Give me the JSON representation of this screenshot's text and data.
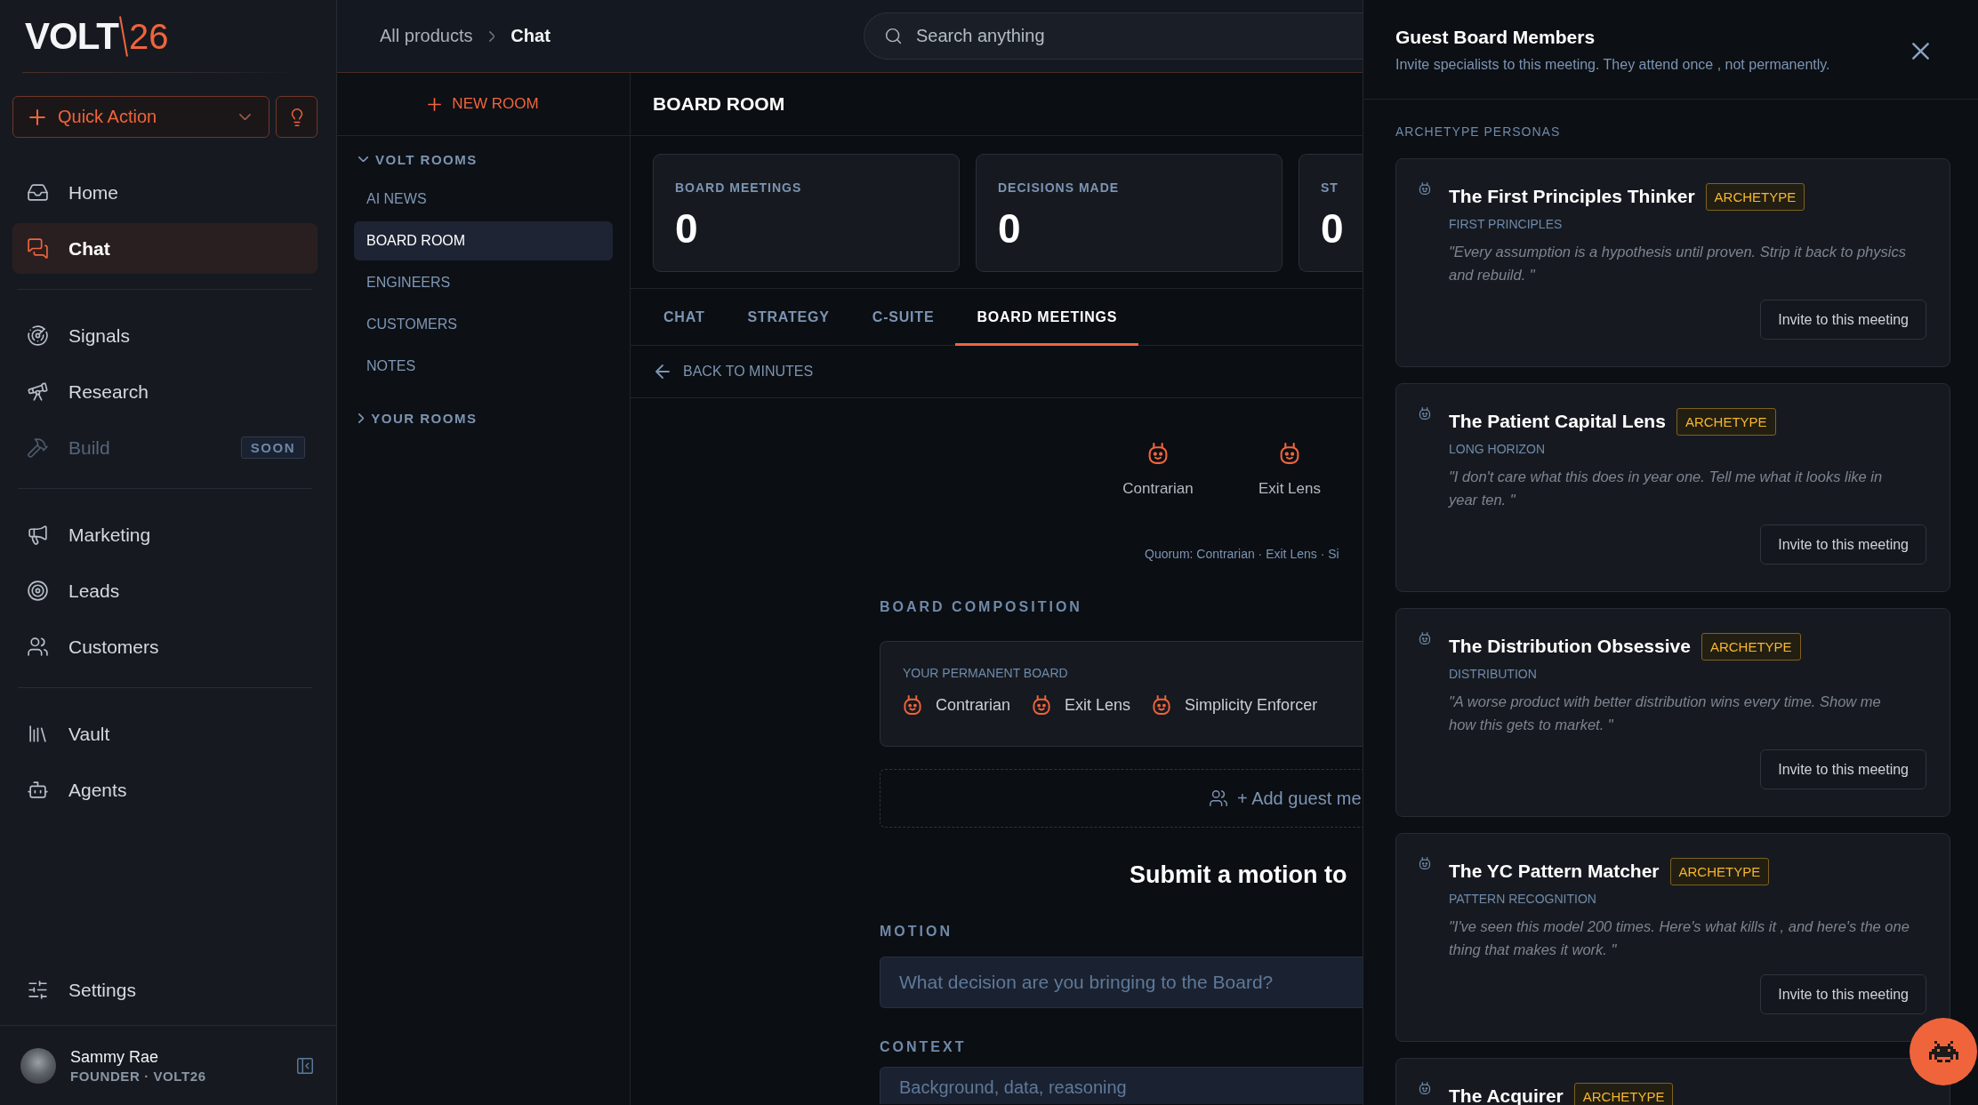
{
  "sidebar": {
    "logo": {
      "word": "VOLT",
      "number": "26"
    },
    "quick_action": {
      "label": "Quick Action"
    },
    "nav_sections": [
      {
        "items": [
          {
            "label": "Home",
            "selected": false,
            "disabled": false
          },
          {
            "label": "Chat",
            "selected": true,
            "disabled": false
          }
        ]
      },
      {
        "items": [
          {
            "label": "Signals",
            "selected": false,
            "disabled": false
          },
          {
            "label": "Research",
            "selected": false,
            "disabled": false
          },
          {
            "label": "Build",
            "selected": false,
            "disabled": true,
            "badge": "SOON"
          }
        ]
      },
      {
        "items": [
          {
            "label": "Marketing",
            "selected": false,
            "disabled": false
          },
          {
            "label": "Leads",
            "selected": false,
            "disabled": false
          },
          {
            "label": "Customers",
            "selected": false,
            "disabled": false
          }
        ]
      },
      {
        "items": [
          {
            "label": "Vault",
            "selected": false,
            "disabled": false
          },
          {
            "label": "Agents",
            "selected": false,
            "disabled": false
          }
        ]
      }
    ],
    "settings": {
      "label": "Settings"
    },
    "user": {
      "name": "Sammy Rae",
      "role": "FOUNDER · VOLT26"
    }
  },
  "topbar": {
    "breadcrumb": [
      "All products",
      "Chat"
    ],
    "search": {
      "placeholder": "Search anything"
    }
  },
  "rooms": {
    "new_room": "NEW ROOM",
    "groups": [
      {
        "label": "VOLT ROOMS",
        "expanded": true,
        "rooms": [
          {
            "label": "AI NEWS",
            "selected": false
          },
          {
            "label": "BOARD ROOM",
            "selected": true
          },
          {
            "label": "ENGINEERS",
            "selected": false
          },
          {
            "label": "CUSTOMERS",
            "selected": false
          },
          {
            "label": "NOTES",
            "selected": false
          }
        ]
      },
      {
        "label": "YOUR ROOMS",
        "expanded": false
      }
    ]
  },
  "main": {
    "title": "BOARD ROOM",
    "stats": [
      {
        "label": "BOARD MEETINGS",
        "value": "0"
      },
      {
        "label": "DECISIONS MADE",
        "value": "0"
      },
      {
        "label": "ST",
        "value": "0"
      }
    ],
    "tabs": [
      {
        "label": "CHAT",
        "selected": false
      },
      {
        "label": "STRATEGY",
        "selected": false
      },
      {
        "label": "C-SUITE",
        "selected": false
      },
      {
        "label": "BOARD MEETINGS",
        "selected": true
      }
    ],
    "back": "BACK TO MINUTES",
    "attendees": [
      "Contrarian",
      "Exit Lens"
    ],
    "quorum": "Quorum: Contrarian · Exit Lens · Si",
    "composition": {
      "heading": "BOARD COMPOSITION",
      "label": "YOUR PERMANENT BOARD",
      "members": [
        "Contrarian",
        "Exit Lens",
        "Simplicity Enforcer"
      ]
    },
    "add_guest": "+ Add guest me",
    "motion_heading": "Submit a motion to",
    "fields": [
      {
        "kind": "input",
        "label": "MOTION",
        "placeholder": "What decision are you bringing to the Board?"
      },
      {
        "kind": "textarea",
        "label": "CONTEXT",
        "placeholder": "Background, data, reasoning"
      }
    ]
  },
  "drawer": {
    "title": "Guest Board Members",
    "subtitle": "Invite specialists to this meeting. They attend once , not permanently.",
    "section": "ARCHETYPE PERSONAS",
    "personas": [
      {
        "name": "The First Principles Thinker",
        "badge": "ARCHETYPE",
        "focus": "FIRST PRINCIPLES",
        "quote": "\"Every assumption is a hypothesis until proven. Strip it back to physics and rebuild. \"",
        "action": "Invite to this meeting"
      },
      {
        "name": "The Patient Capital Lens",
        "badge": "ARCHETYPE",
        "focus": "LONG HORIZON",
        "quote": "\"I don't care what this does in year one. Tell me what it looks like in year ten. \"",
        "action": "Invite to this meeting"
      },
      {
        "name": "The Distribution Obsessive",
        "badge": "ARCHETYPE",
        "focus": "DISTRIBUTION",
        "quote": "\"A worse product with better distribution wins every time. Show me how this gets to market. \"",
        "action": "Invite to this meeting"
      },
      {
        "name": "The YC Pattern Matcher",
        "badge": "ARCHETYPE",
        "focus": "PATTERN RECOGNITION",
        "quote": "\"I've seen this model 200 times. Here's what kills it , and here's the one thing that makes it work. \"",
        "action": "Invite to this meeting"
      },
      {
        "name": "The Acquirer",
        "badge": "ARCHETYPE"
      }
    ]
  }
}
